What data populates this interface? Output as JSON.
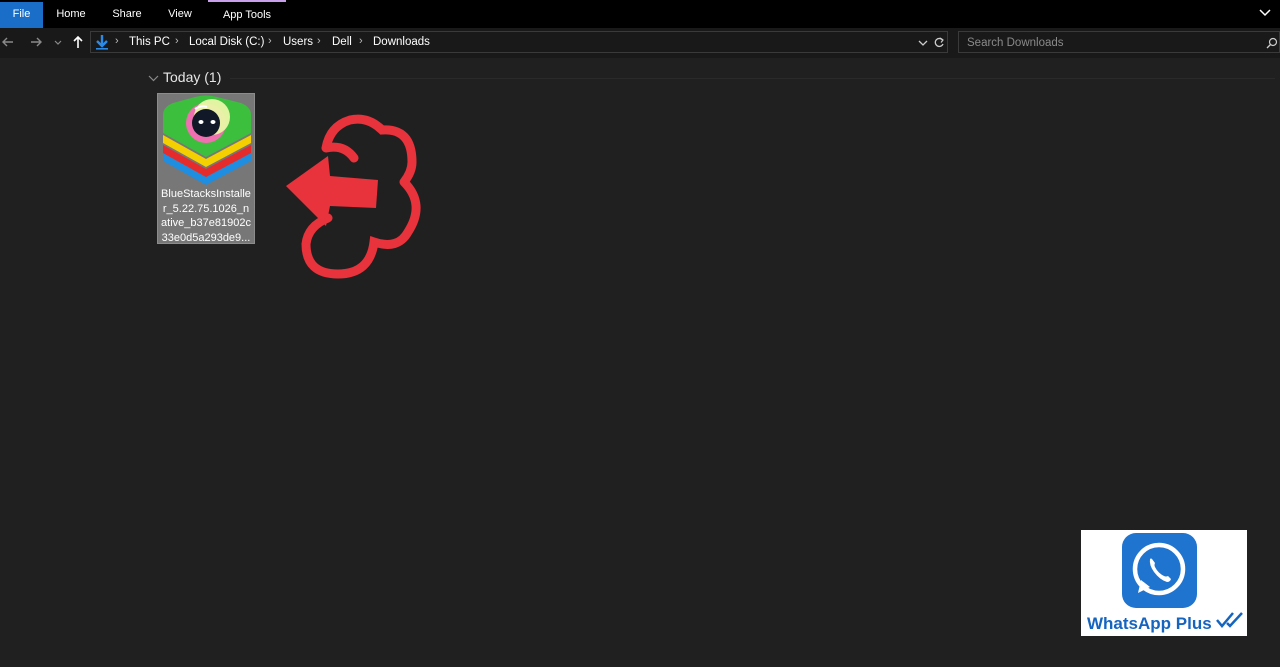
{
  "ribbon": {
    "tabs": [
      "File",
      "Home",
      "Share",
      "View",
      "App Tools"
    ]
  },
  "nav": {
    "breadcrumbs": [
      "This PC",
      "Local Disk (C:)",
      "Users",
      "Dell",
      "Downloads"
    ]
  },
  "search": {
    "placeholder": "Search Downloads"
  },
  "content": {
    "group_label": "Today (1)",
    "file": {
      "name": "BlueStacksInstaller_5.22.75.1026_native_b37e81902c33e0d5a293de9...",
      "icon": "bluestacks-icon"
    }
  },
  "overlay": {
    "watermark_text": "WhatsApp Plus",
    "arrow_icon": "red-curved-arrow-icon",
    "accent": "#e8323c",
    "brand": "#1565c0"
  }
}
